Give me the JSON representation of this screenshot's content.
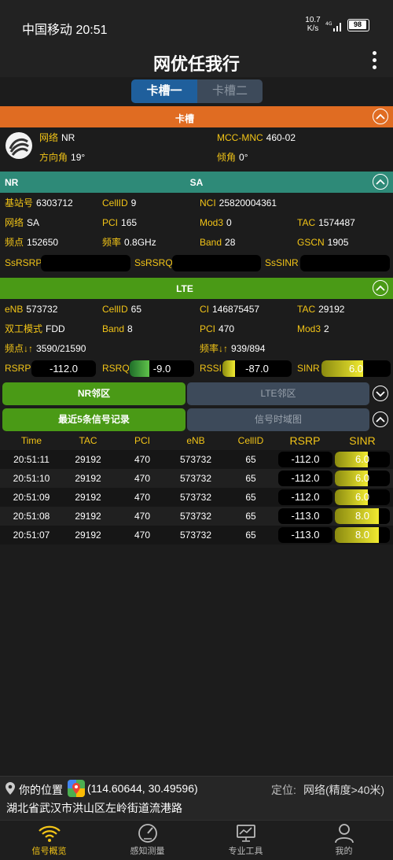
{
  "status_bar": {
    "carrier_time": "中国移动 20:51",
    "speed": "10.7",
    "speed_unit": "K/s",
    "battery": "98"
  },
  "app": {
    "title": "网优任我行"
  },
  "slot_tabs": [
    {
      "label": "卡槽一",
      "active": true
    },
    {
      "label": "卡槽二",
      "active": false
    }
  ],
  "card": {
    "header": "卡槽",
    "network_label": "网络",
    "network_value": "NR",
    "mcc_label": "MCC-MNC",
    "mcc_value": "460-02",
    "azimuth_label": "方向角",
    "azimuth_value": "19°",
    "tilt_label": "倾角",
    "tilt_value": "0°"
  },
  "nr": {
    "header_left": "NR",
    "header_center": "SA",
    "base_label": "基站号",
    "base_value": "6303712",
    "cellid_label": "CellID",
    "cellid_value": "9",
    "nci_label": "NCI",
    "nci_value": "25820004361",
    "net_label": "网络",
    "net_value": "SA",
    "pci_label": "PCI",
    "pci_value": "165",
    "mod3_label": "Mod3",
    "mod3_value": "0",
    "tac_label": "TAC",
    "tac_value": "1574487",
    "freqpt_label": "频点",
    "freqpt_value": "152650",
    "freq_label": "频率",
    "freq_value": "0.8GHz",
    "band_label": "Band",
    "band_value": "28",
    "gscn_label": "GSCN",
    "gscn_value": "1905",
    "ssrsrp_label": "SsRSRP",
    "ssrsrq_label": "SsRSRQ",
    "sssinr_label": "SsSINR"
  },
  "lte": {
    "header": "LTE",
    "enb_label": "eNB",
    "enb_value": "573732",
    "cellid_label": "CellID",
    "cellid_value": "65",
    "ci_label": "CI",
    "ci_value": "146875457",
    "tac_label": "TAC",
    "tac_value": "29192",
    "duplex_label": "双工模式",
    "duplex_value": "FDD",
    "band_label": "Band",
    "band_value": "8",
    "pci_label": "PCI",
    "pci_value": "470",
    "mod3_label": "Mod3",
    "mod3_value": "2",
    "freqpt_label": "频点↓↑",
    "freqpt_value": "3590/21590",
    "freq_label": "频率↓↑",
    "freq_value": "939/894",
    "rsrp_label": "RSRP",
    "rsrp_value": "-112.0",
    "rsrq_label": "RSRQ",
    "rsrq_value": "-9.0",
    "rssi_label": "RSSI",
    "rssi_value": "-87.0",
    "sinr_label": "SINR",
    "sinr_value": "6.0",
    "rsrq_fill": 0.3,
    "rssi_fill": 0.18,
    "sinr_fill": 0.6
  },
  "neighbor_tabs": [
    {
      "label": "NR邻区",
      "active": true
    },
    {
      "label": "LTE邻区",
      "active": false
    }
  ],
  "record_tabs": [
    {
      "label": "最近5条信号记录",
      "active": true
    },
    {
      "label": "信号时域图",
      "active": false
    }
  ],
  "table": {
    "headers": [
      "Time",
      "TAC",
      "PCI",
      "eNB",
      "CellID",
      "RSRP",
      "SINR"
    ],
    "rows": [
      [
        "20:51:11",
        "29192",
        "470",
        "573732",
        "65",
        "-112.0",
        "6.0"
      ],
      [
        "20:51:10",
        "29192",
        "470",
        "573732",
        "65",
        "-112.0",
        "6.0"
      ],
      [
        "20:51:09",
        "29192",
        "470",
        "573732",
        "65",
        "-112.0",
        "6.0"
      ],
      [
        "20:51:08",
        "29192",
        "470",
        "573732",
        "65",
        "-113.0",
        "8.0"
      ],
      [
        "20:51:07",
        "29192",
        "470",
        "573732",
        "65",
        "-113.0",
        "8.0"
      ]
    ],
    "sinr_fills": [
      0.6,
      0.6,
      0.6,
      0.8,
      0.8
    ]
  },
  "location": {
    "label": "你的位置",
    "coords": "(114.60644, 30.49596)",
    "mode_label": "定位:",
    "mode_value": "网络(精度>40米)",
    "address": "湖北省武汉市洪山区左岭街道流港路"
  },
  "bottom_nav": [
    {
      "label": "信号概览",
      "icon": "wifi-icon",
      "active": true
    },
    {
      "label": "感知测量",
      "icon": "speedometer-icon",
      "active": false
    },
    {
      "label": "专业工具",
      "icon": "chart-monitor-icon",
      "active": false
    },
    {
      "label": "我的",
      "icon": "person-icon",
      "active": false
    }
  ],
  "colors": {
    "orange": "#e06c22",
    "teal": "#2e8a78",
    "green": "#4a9a16",
    "gold": "#f2c417",
    "tab_blue": "#1f5f9c",
    "tab_inactive": "#3d4a5a",
    "accent_nav": "#f2c417"
  }
}
